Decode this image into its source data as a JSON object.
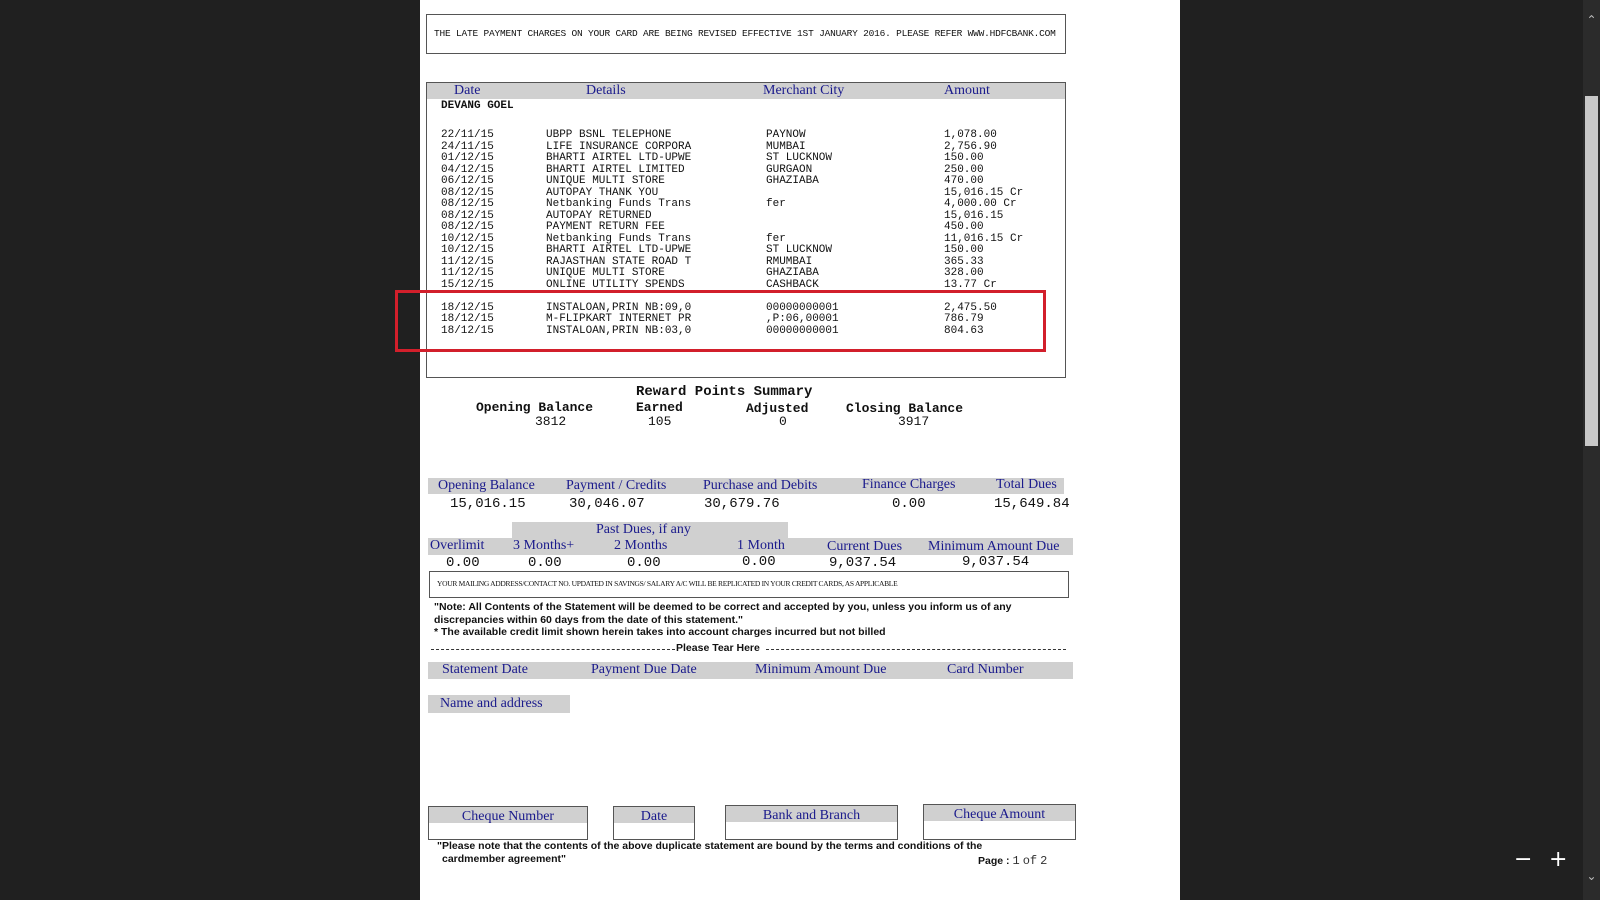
{
  "notice": "THE LATE PAYMENT CHARGES ON YOUR CARD ARE BEING REVISED EFFECTIVE 1ST JANUARY 2016. PLEASE REFER WWW.HDFCBANK.COM",
  "tx_headers": [
    "Date",
    "Details",
    "Merchant City",
    "Amount"
  ],
  "cardholder": "DEVANG GOEL",
  "transactions": [
    {
      "date": "22/11/15",
      "details": "UBPP BSNL TELEPHONE",
      "city": "PAYNOW",
      "amount": "1,078.00"
    },
    {
      "date": "24/11/15",
      "details": "LIFE INSURANCE CORPORA",
      "city": "MUMBAI",
      "amount": "2,756.90"
    },
    {
      "date": "01/12/15",
      "details": "BHARTI AIRTEL LTD-UPWE",
      "city": "ST LUCKNOW",
      "amount": "150.00"
    },
    {
      "date": "04/12/15",
      "details": "BHARTI AIRTEL LIMITED",
      "city": "GURGAON",
      "amount": "250.00"
    },
    {
      "date": "06/12/15",
      "details": "UNIQUE MULTI STORE",
      "city": "GHAZIABA",
      "amount": "470.00"
    },
    {
      "date": "08/12/15",
      "details": "AUTOPAY THANK YOU",
      "city": "",
      "amount": "15,016.15 Cr"
    },
    {
      "date": "08/12/15",
      "details": "Netbanking Funds Trans",
      "city": "fer",
      "amount": "4,000.00 Cr"
    },
    {
      "date": "08/12/15",
      "details": "AUTOPAY RETURNED",
      "city": "",
      "amount": "15,016.15"
    },
    {
      "date": "08/12/15",
      "details": "PAYMENT RETURN FEE",
      "city": "",
      "amount": "450.00"
    },
    {
      "date": "10/12/15",
      "details": "Netbanking Funds Trans",
      "city": "fer",
      "amount": "11,016.15 Cr"
    },
    {
      "date": "10/12/15",
      "details": "BHARTI AIRTEL LTD-UPWE",
      "city": "ST LUCKNOW",
      "amount": "150.00"
    },
    {
      "date": "11/12/15",
      "details": "RAJASTHAN STATE ROAD T",
      "city": "RMUMBAI",
      "amount": "365.33"
    },
    {
      "date": "11/12/15",
      "details": "UNIQUE MULTI STORE",
      "city": "GHAZIABA",
      "amount": "328.00"
    },
    {
      "date": "15/12/15",
      "details": "ONLINE UTILITY SPENDS",
      "city": "CASHBACK",
      "amount": "13.77 Cr"
    },
    {
      "date": "18/12/15",
      "details": "INSTALOAN,PRIN NB:09,0",
      "city": "00000000001",
      "amount": "2,475.50"
    },
    {
      "date": "18/12/15",
      "details": "M-FLIPKART INTERNET PR",
      "city": ",P:06,00001",
      "amount": "786.79"
    },
    {
      "date": "18/12/15",
      "details": "INSTALOAN,PRIN NB:03,0",
      "city": "00000000001",
      "amount": "804.63"
    }
  ],
  "rewards": {
    "title": "Reward Points Summary",
    "labels": [
      "Opening Balance",
      "Earned",
      "Adjusted",
      "Closing Balance"
    ],
    "values": [
      "3812",
      "105",
      "0",
      "3917"
    ]
  },
  "summary": {
    "labels": [
      "Opening Balance",
      "Payment / Credits",
      "Purchase and Debits",
      "Finance Charges",
      "Total Dues"
    ],
    "values": [
      "15,016.15",
      "30,046.07",
      "30,679.76",
      "0.00",
      "15,649.84"
    ]
  },
  "dues": {
    "past_dues_title": "Past Dues, if any",
    "labels": [
      "Overlimit",
      "3 Months+",
      "2 Months",
      "1 Month",
      "Current Dues",
      "Minimum Amount Due"
    ],
    "values": [
      "0.00",
      "0.00",
      "0.00",
      "0.00",
      "9,037.54",
      "9,037.54"
    ]
  },
  "mailing_notice": "YOUR MAILING ADDRESS/CONTACT NO. UPDATED IN SAVINGS/ SALARY A/C WILL BE REPLICATED IN YOUR CREDIT CARDS, AS APPLICABLE",
  "note_line1": "\"Note: All Contents of the Statement will be deemed to be correct and accepted by you, unless you inform us of any",
  "note_line2": "discrepancies within 60 days from the date of this statement.\"",
  "note_line3": "* The available credit limit shown herein takes into account charges incurred but not billed",
  "tear_here": "Please Tear Here",
  "slip_headers": [
    "Statement Date",
    "Payment Due Date",
    "Minimum Amount Due",
    "Card Number"
  ],
  "name_address": "Name and address",
  "cheque_fields": [
    "Cheque Number",
    "Date",
    "Bank and Branch",
    "Cheque Amount"
  ],
  "footer_line1": "\"Please note that the contents of the above duplicate statement are bound by the terms and conditions of the",
  "footer_line2": "cardmember agreement\"",
  "page_label": "Page :",
  "page_number": "1",
  "page_of": "of",
  "page_total": "2",
  "zoom_out": "−",
  "zoom_in": "+"
}
